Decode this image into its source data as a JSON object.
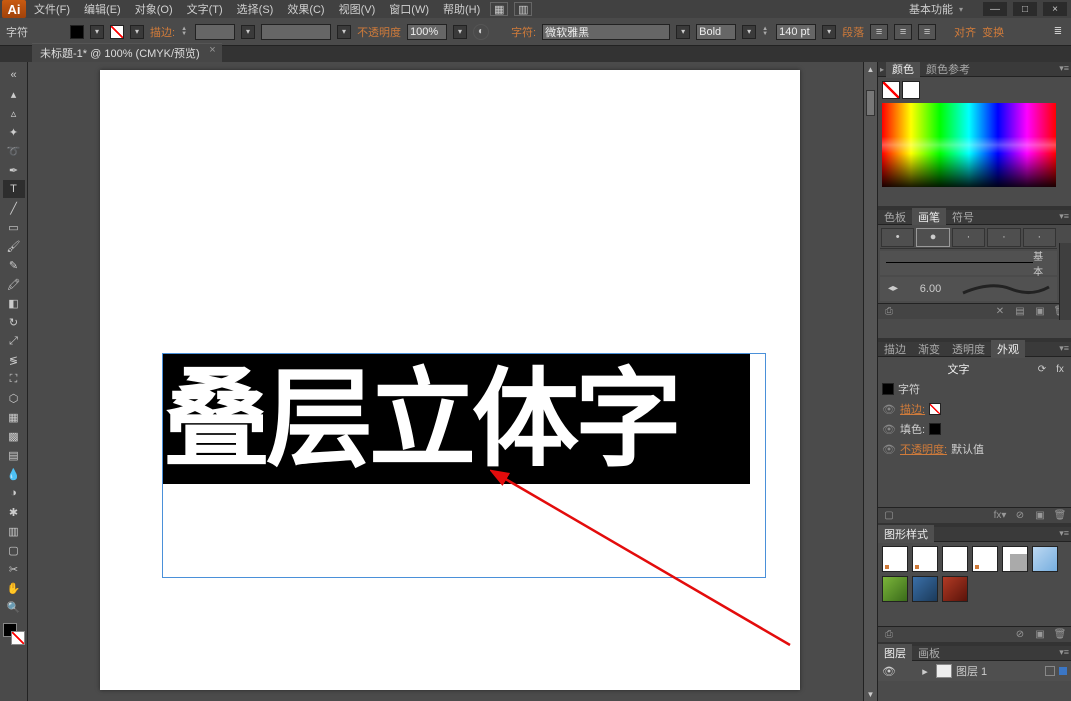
{
  "app_icon": "Ai",
  "menu": {
    "file": "文件(F)",
    "edit": "编辑(E)",
    "object": "对象(O)",
    "type": "文字(T)",
    "select": "选择(S)",
    "effect": "效果(C)",
    "view": "视图(V)",
    "window": "窗口(W)",
    "help": "帮助(H)"
  },
  "workspace_label": "基本功能",
  "window_buttons": {
    "min": "—",
    "max": "□",
    "close": "×"
  },
  "options": {
    "tool_context": "字符",
    "stroke_label": "描边:",
    "opacity_label": "不透明度",
    "opacity_value": "100%",
    "char_label": "字符:",
    "font_family": "微软雅黑",
    "font_style": "Bold",
    "font_size": "140 pt",
    "paragraph": "段落",
    "align": "对齐",
    "transform": "变换"
  },
  "document_tab": {
    "label": "未标题-1* @ 100% (CMYK/预览)"
  },
  "canvas": {
    "main_text": "叠层立体字"
  },
  "panels": {
    "color": {
      "tab_color": "颜色",
      "tab_guide": "颜色参考"
    },
    "brush": {
      "tabs": {
        "swatches": "色板",
        "brushes": "画笔",
        "symbols": "符号"
      },
      "basic_label": "基本",
      "brush_size": "6.00"
    },
    "grad_appearance": {
      "tabs": {
        "stroke": "描边",
        "gradient": "渐变",
        "transparency": "透明度",
        "appearance": "外观"
      },
      "header": "文字",
      "row_char": "字符",
      "row_stroke": "描边:",
      "row_fill": "填色:",
      "row_opacity_label": "不透明度:",
      "row_opacity_value": "默认值"
    },
    "gstyle": {
      "tab": "图形样式"
    },
    "layers": {
      "tabs": {
        "layers": "图层",
        "artboards": "画板"
      },
      "layer1": "图层 1"
    }
  }
}
